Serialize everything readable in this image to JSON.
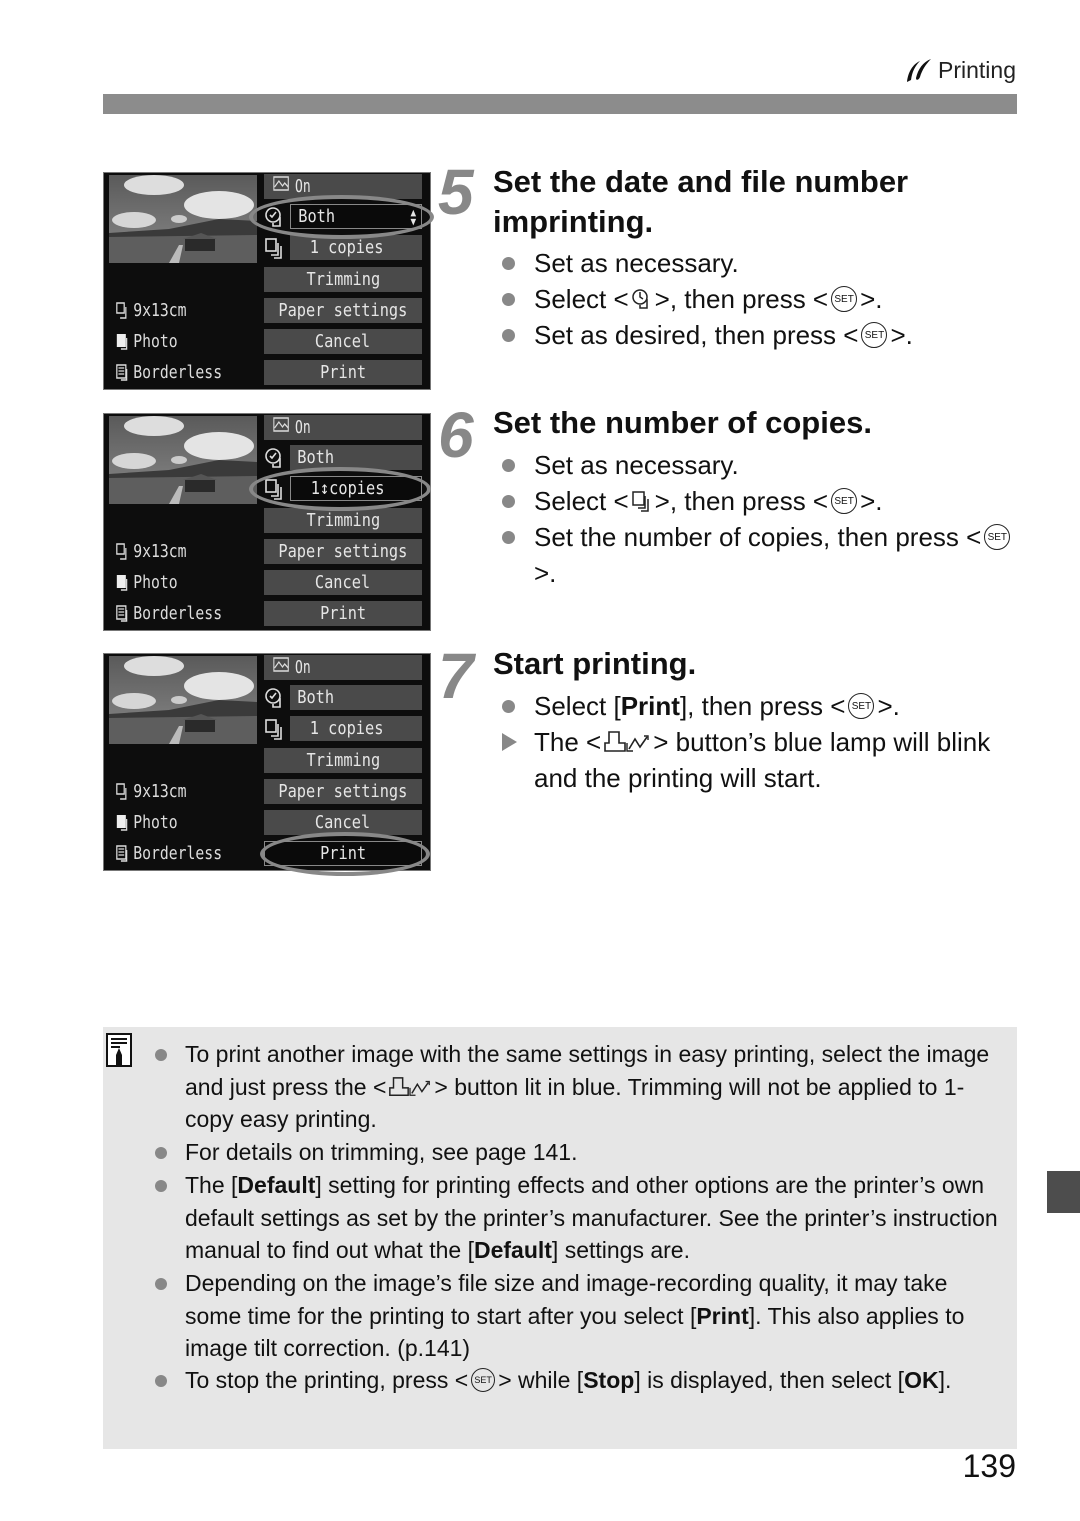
{
  "header": {
    "section_icon": "printing-icon",
    "section": "Printing"
  },
  "screens": [
    {
      "highlight": "date-imprint",
      "rows": {
        "effect": "On",
        "date_imprint": "Both",
        "copies": "1  copies",
        "trimming": "Trimming",
        "paper_settings": "Paper settings",
        "cancel": "Cancel",
        "print": "Print"
      },
      "info": {
        "paper_size": "9x13cm",
        "paper_type": "Photo",
        "layout": "Borderless"
      }
    },
    {
      "highlight": "copies",
      "rows": {
        "effect": "On",
        "date_imprint": "Both",
        "copies": "1↕copies",
        "trimming": "Trimming",
        "paper_settings": "Paper settings",
        "cancel": "Cancel",
        "print": "Print"
      },
      "info": {
        "paper_size": "9x13cm",
        "paper_type": "Photo",
        "layout": "Borderless"
      }
    },
    {
      "highlight": "print",
      "rows": {
        "effect": "On",
        "date_imprint": "Both",
        "copies": "1  copies",
        "trimming": "Trimming",
        "paper_settings": "Paper settings",
        "cancel": "Cancel",
        "print": "Print"
      },
      "info": {
        "paper_size": "9x13cm",
        "paper_type": "Photo",
        "layout": "Borderless"
      }
    }
  ],
  "steps": [
    {
      "number": "5",
      "title": "Set the date and file number imprinting.",
      "bullets": [
        {
          "type": "dot",
          "text": "Set as necessary."
        },
        {
          "type": "dot",
          "pre": "Select <",
          "icon": "date-imprint-icon",
          "mid": ">, then press <",
          "button": "SET",
          "post": ">."
        },
        {
          "type": "dot",
          "pre": "Set as desired, then press <",
          "button": "SET",
          "post": ">."
        }
      ]
    },
    {
      "number": "6",
      "title": "Set the number of copies.",
      "bullets": [
        {
          "type": "dot",
          "text": "Set as necessary."
        },
        {
          "type": "dot",
          "pre": "Select <",
          "icon": "copies-icon",
          "mid": ">, then press <",
          "button": "SET",
          "post": ">."
        },
        {
          "type": "dot",
          "pre": "Set the number of copies, then press <",
          "button": "SET",
          "post": ">."
        }
      ]
    },
    {
      "number": "7",
      "title": "Start printing.",
      "bullets": [
        {
          "type": "dot",
          "pre": "Select [",
          "bold": "Print",
          "mid": "], then press <",
          "button": "SET",
          "post": ">."
        },
        {
          "type": "arrow",
          "pre": "The <",
          "icon": "print-share-icon",
          "post": "> button’s blue lamp will blink and the printing will start."
        }
      ]
    }
  ],
  "notes": {
    "icon": "memo-icon",
    "items": [
      {
        "a": "To print another image with the same settings in easy printing, select the image and just press the <",
        "icon": "print-share-icon",
        "b": "> button lit in blue. Trimming will not be applied to 1-copy easy printing."
      },
      {
        "a": "For details on trimming, see page 141."
      },
      {
        "a": "The [",
        "bold1": "Default",
        "b": "] setting for printing effects and other options are the printer’s own default settings as set by the printer’s manufacturer. See the printer’s instruction manual to find out what the [",
        "bold2": "Default",
        "c": "] settings are."
      },
      {
        "a": "Depending on the image’s file size and image-recording quality, it may take some time for the printing to start after you select [",
        "bold1": "Print",
        "b": "]. This also applies to image tilt correction. (p.141)"
      },
      {
        "a": "To stop the printing, press <",
        "button": "SET",
        "b": "> while [",
        "bold1": "Stop",
        "c": "] is displayed, then select [",
        "bold2": "OK",
        "d": "]."
      }
    ]
  },
  "page_number": "139",
  "colors": {
    "header_bar": "#8c8c8c",
    "note_bg": "#e6e6e6",
    "step_number": "#888888",
    "lcd_bg": "#0d0d0d",
    "lcd_row": "#4a4a4a",
    "thumb_tab": "#4d4d4d"
  }
}
